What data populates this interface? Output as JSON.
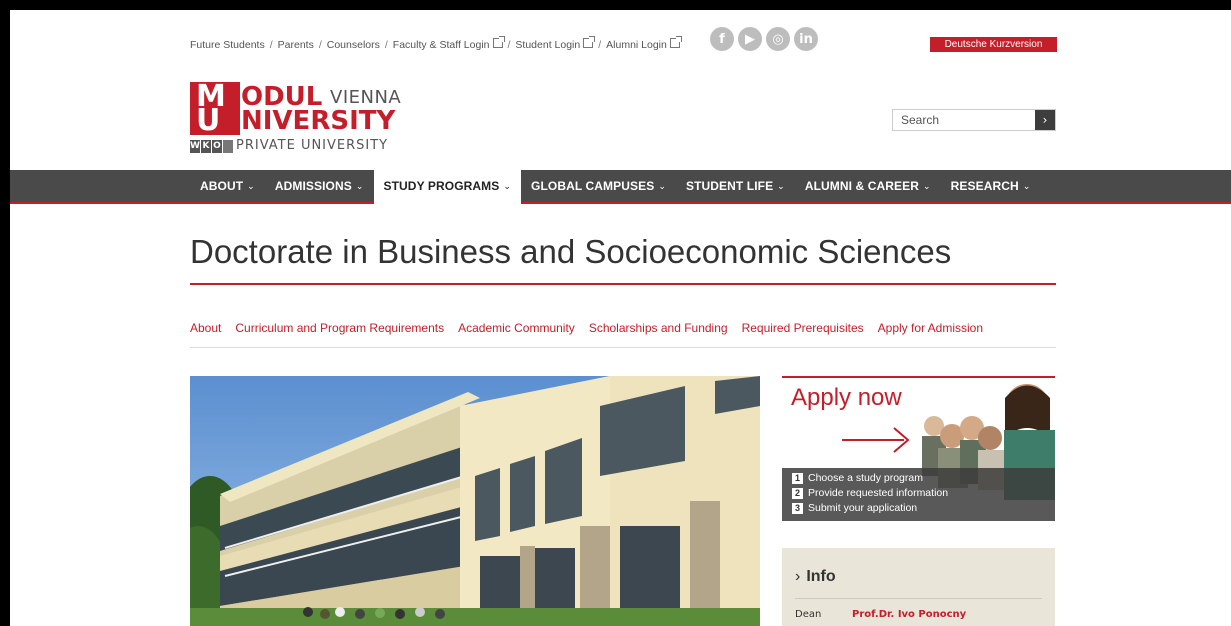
{
  "top_links": [
    {
      "label": "Future Students",
      "external": false
    },
    {
      "label": "Parents",
      "external": false
    },
    {
      "label": "Counselors",
      "external": false
    },
    {
      "label": "Faculty & Staff Login",
      "external": true
    },
    {
      "label": "Student Login",
      "external": true
    },
    {
      "label": "Alumni Login",
      "external": true
    }
  ],
  "social": [
    {
      "icon": "facebook-icon",
      "glyph": "f"
    },
    {
      "icon": "youtube-icon",
      "glyph": "▶"
    },
    {
      "icon": "instagram-icon",
      "glyph": "◎"
    },
    {
      "icon": "linkedin-icon",
      "glyph": "in"
    }
  ],
  "german_link": "Deutsche Kurzversion",
  "logo": {
    "m": "M",
    "odul": "ODUL",
    "vienna": "VIENNA",
    "u": "U",
    "niversity": "NIVERSITY",
    "wko": [
      "W",
      "K",
      "O"
    ],
    "private": "PRIVATE UNIVERSITY"
  },
  "search": {
    "placeholder": "Search",
    "button": "›"
  },
  "nav": [
    {
      "label": "ABOUT",
      "active": false
    },
    {
      "label": "ADMISSIONS",
      "active": false
    },
    {
      "label": "STUDY PROGRAMS",
      "active": true
    },
    {
      "label": "GLOBAL CAMPUSES",
      "active": false
    },
    {
      "label": "STUDENT LIFE",
      "active": false
    },
    {
      "label": "ALUMNI & CAREER",
      "active": false
    },
    {
      "label": "RESEARCH",
      "active": false
    }
  ],
  "nav_caret": "⌄",
  "page_title": "Doctorate in Business and Socioeconomic Sciences",
  "sub_nav": [
    "About",
    "Curriculum and Program Requirements",
    "Academic Community",
    "Scholarships and Funding",
    "Required Prerequisites",
    "Apply for Admission"
  ],
  "apply": {
    "heading": "Apply now",
    "steps": [
      {
        "num": "1",
        "text": "Choose a study program"
      },
      {
        "num": "2",
        "text": "Provide requested information"
      },
      {
        "num": "3",
        "text": "Submit your application"
      }
    ]
  },
  "info": {
    "heading": "Info",
    "chevron": "›",
    "rows": [
      {
        "key": "Dean",
        "value": "Prof.Dr. Ivo Ponocny"
      }
    ]
  },
  "colors": {
    "brand_red": "#c41e2a",
    "nav_bg": "#4a4a4a",
    "info_bg": "#e9e5d8"
  }
}
